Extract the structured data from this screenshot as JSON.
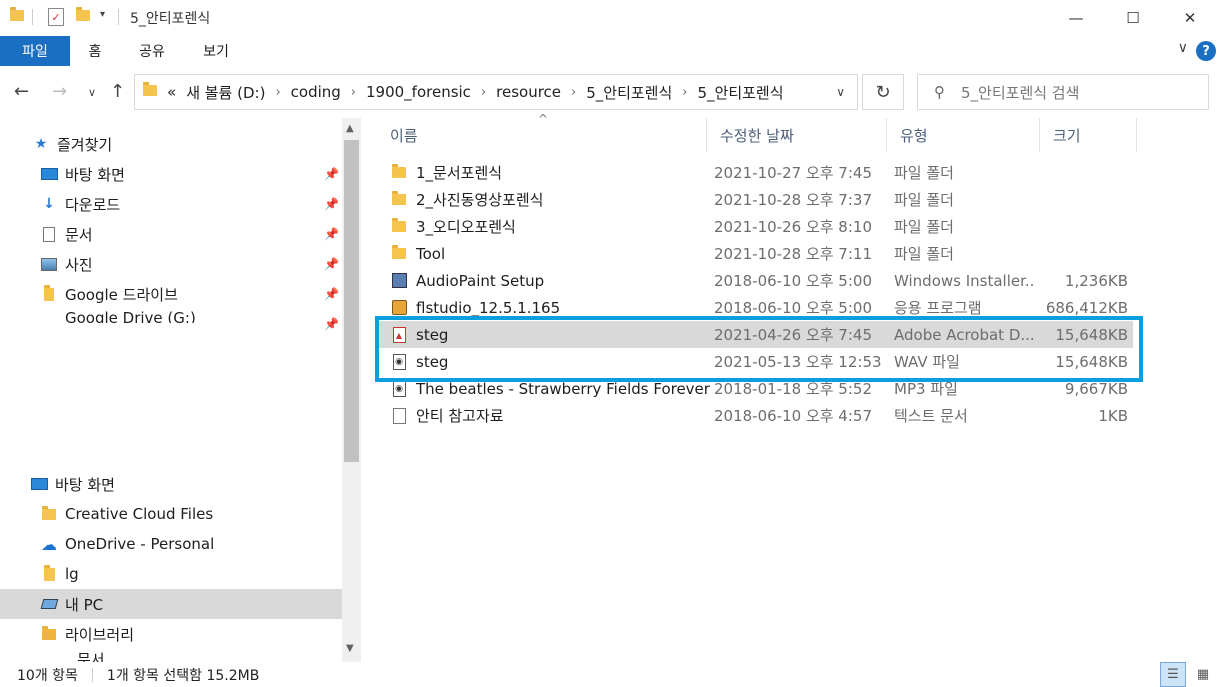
{
  "window": {
    "title": "5_안티포렌식",
    "minimize": "—",
    "maximize": "☐",
    "close": "✕"
  },
  "ribbon": {
    "tabs": [
      "파일",
      "홈",
      "공유",
      "보기"
    ],
    "collapse": "∨",
    "help": "?"
  },
  "address": {
    "overflow": "«",
    "crumbs": [
      "새 볼륨 (D:)",
      "coding",
      "1900_forensic",
      "resource",
      "5_안티포렌식",
      "5_안티포렌식"
    ],
    "separator": "›",
    "dropdown": "∨",
    "search_placeholder": "5_안티포렌식 검색"
  },
  "nav": {
    "quick_access": "즐겨찾기",
    "quick_items": [
      "바탕 화면",
      "다운로드",
      "문서",
      "사진",
      "Google 드라이브",
      "Google Drive (G:)"
    ],
    "tree_items": [
      "바탕 화면",
      "Creative Cloud Files",
      "OneDrive - Personal",
      "lg",
      "내 PC",
      "라이브러리",
      "문서"
    ],
    "pin_glyph": "📌"
  },
  "columns": {
    "name": "이름",
    "date": "수정한 날짜",
    "type": "유형",
    "size": "크기"
  },
  "files": [
    {
      "name": "1_문서포렌식",
      "date": "2021-10-27 오후 7:45",
      "type": "파일 폴더",
      "size": "",
      "icon": "folder-icon"
    },
    {
      "name": "2_사진동영상포렌식",
      "date": "2021-10-28 오후 7:37",
      "type": "파일 폴더",
      "size": "",
      "icon": "folder-icon"
    },
    {
      "name": "3_오디오포렌식",
      "date": "2021-10-26 오후 8:10",
      "type": "파일 폴더",
      "size": "",
      "icon": "folder-icon"
    },
    {
      "name": "Tool",
      "date": "2021-10-28 오후 7:11",
      "type": "파일 폴더",
      "size": "",
      "icon": "folder-icon"
    },
    {
      "name": "AudioPaint Setup",
      "date": "2018-06-10 오후 5:00",
      "type": "Windows Installer...",
      "size": "1,236KB",
      "icon": "installer-icon"
    },
    {
      "name": "flstudio_12.5.1.165",
      "date": "2018-06-10 오후 5:00",
      "type": "응용 프로그램",
      "size": "686,412KB",
      "icon": "application-icon"
    },
    {
      "name": "steg",
      "date": "2021-04-26 오후 7:45",
      "type": "Adobe Acrobat D...",
      "size": "15,648KB",
      "icon": "pdf-icon"
    },
    {
      "name": "steg",
      "date": "2021-05-13 오후 12:53",
      "type": "WAV 파일",
      "size": "15,648KB",
      "icon": "audio-file-icon"
    },
    {
      "name": "The beatles - Strawberry Fields Forever",
      "date": "2018-01-18 오후 5:52",
      "type": "MP3 파일",
      "size": "9,667KB",
      "icon": "audio-file-icon"
    },
    {
      "name": "안티 참고자료",
      "date": "2018-06-10 오후 4:57",
      "type": "텍스트 문서",
      "size": "1KB",
      "icon": "text-file-icon"
    }
  ],
  "status": {
    "count": "10개 항목",
    "selection": "1개 항목 선택함 15.2MB"
  },
  "colors": {
    "accent": "#1b6fc2",
    "highlight_box": "#0aa0e0",
    "selection": "#d9d9d9"
  }
}
